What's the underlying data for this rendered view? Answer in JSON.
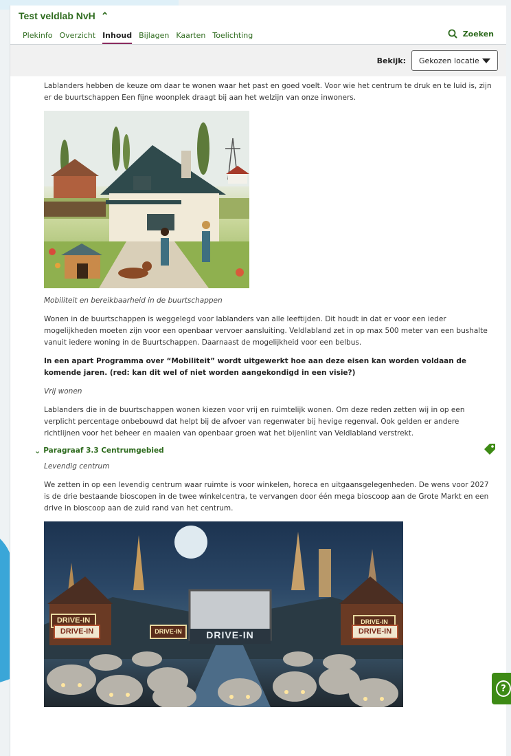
{
  "header": {
    "title": "Test veldlab NvH"
  },
  "tabs": [
    {
      "label": "Plekinfo"
    },
    {
      "label": "Overzicht"
    },
    {
      "label": "Inhoud",
      "active": true
    },
    {
      "label": "Bijlagen"
    },
    {
      "label": "Kaarten"
    },
    {
      "label": "Toelichting"
    }
  ],
  "search": {
    "label": "Zoeken"
  },
  "view": {
    "label": "Bekijk:",
    "selected": "Gekozen locatie"
  },
  "content": {
    "p1": "Lablanders hebben de keuze om daar te wonen waar het past en goed voelt. Voor wie het centrum te druk en te luid is, zijn er de buurtschappen Een fijne woonplek draagt bij aan het welzijn van onze inwoners.",
    "caption1": "Mobiliteit en bereikbaarheid in de buurtschappen",
    "p2": "Wonen in de buurtschappen is weggelegd voor lablanders van alle leeftijden. Dit houdt in dat er voor een ieder mogelijkheden moeten zijn voor een openbaar vervoer aansluiting. Veldlabland zet in op max 500 meter van een bushalte vanuit iedere woning in de Buurtschappen. Daarnaast de mogelijkheid voor een belbus.",
    "p3": "In een apart Programma over “Mobiliteit” wordt uitgewerkt hoe aan deze eisen kan worden voldaan de komende jaren. (red: kan dit wel of niet worden aangekondigd in een visie?)",
    "subhead1": "Vrij wonen",
    "p4": "Lablanders die in de buurtschappen wonen kiezen voor vrij en ruimtelijk wonen. Om deze reden zetten wij in op een verplicht percentage onbebouwd dat helpt bij de afvoer van regenwater bij hevige regenval. Ook gelden er andere richtlijnen voor het beheer en maaien van openbaar groen wat het bijenlint van Veldlabland verstrekt.",
    "section": "Paragraaf 3.3 Centrumgebied",
    "subhead2": "Levendig centrum",
    "p5": "We zetten in op een levendig centrum waar ruimte is voor winkelen, horeca en uitgaansgelegenheden. De wens voor 2027 is de drie bestaande bioscopen in de twee winkelcentra, te vervangen door één mega bioscoop aan de Grote Markt en een drive in bioscoop aan de zuid rand van het centrum."
  },
  "image2_text": {
    "sign_left_1": "DRIVE-IN",
    "sign_left_2": "DRIVE-IN",
    "sign_mid": "DRIVE-IN",
    "screen": "DRIVE-IN",
    "sign_right_1": "DRIVE-IN",
    "sign_right_2": "DRIVE-IN"
  },
  "colors": {
    "accent_green": "#2e6b1e",
    "tab_underline": "#8a2a5e",
    "help_green": "#3d8a14"
  },
  "icons": {
    "search": "search-icon",
    "tag": "tag-icon",
    "help": "help-icon"
  }
}
